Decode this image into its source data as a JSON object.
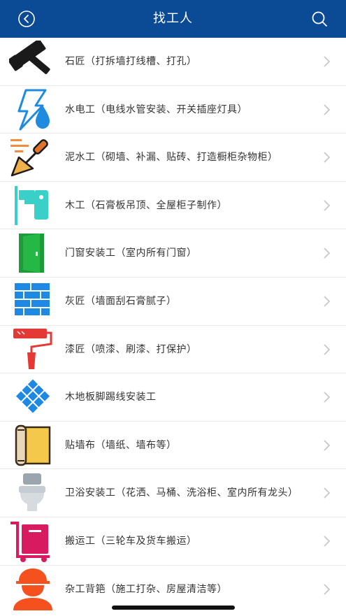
{
  "header": {
    "title": "找工人",
    "back_icon": "back-circle-icon",
    "search_icon": "search-icon",
    "bg_color": "#0b4a94"
  },
  "list": {
    "items": [
      {
        "label": "石匠（打拆墙打线槽、打孔）",
        "icon": "hammer-icon"
      },
      {
        "label": "水电工（电线水管安装、开关插座灯具）",
        "icon": "water-electric-icon"
      },
      {
        "label": "泥水工（砌墙、补漏、贴砖、打造橱柜杂物柜）",
        "icon": "trowel-icon"
      },
      {
        "label": "木工（石膏板吊顶、全屋柜子制作）",
        "icon": "drill-icon"
      },
      {
        "label": "门窗安装工（室内所有门窗）",
        "icon": "door-icon"
      },
      {
        "label": "灰匠（墙面刮石膏腻子）",
        "icon": "brick-wall-icon"
      },
      {
        "label": "漆匠（喷漆、刷漆、打保护）",
        "icon": "paint-roller-icon"
      },
      {
        "label": "木地板脚踢线安装工",
        "icon": "floor-tiles-icon"
      },
      {
        "label": "贴墙布（墙纸、墙布等）",
        "icon": "wallpaper-roll-icon"
      },
      {
        "label": "卫浴安装工（花洒、马桶、洗浴柜、室内所有龙头）",
        "icon": "toilet-icon"
      },
      {
        "label": "搬运工（三轮车及货车搬运）",
        "icon": "hand-truck-icon"
      },
      {
        "label": "杂工背筢（施工打杂、房屋清洁等）",
        "icon": "worker-icon"
      }
    ]
  }
}
